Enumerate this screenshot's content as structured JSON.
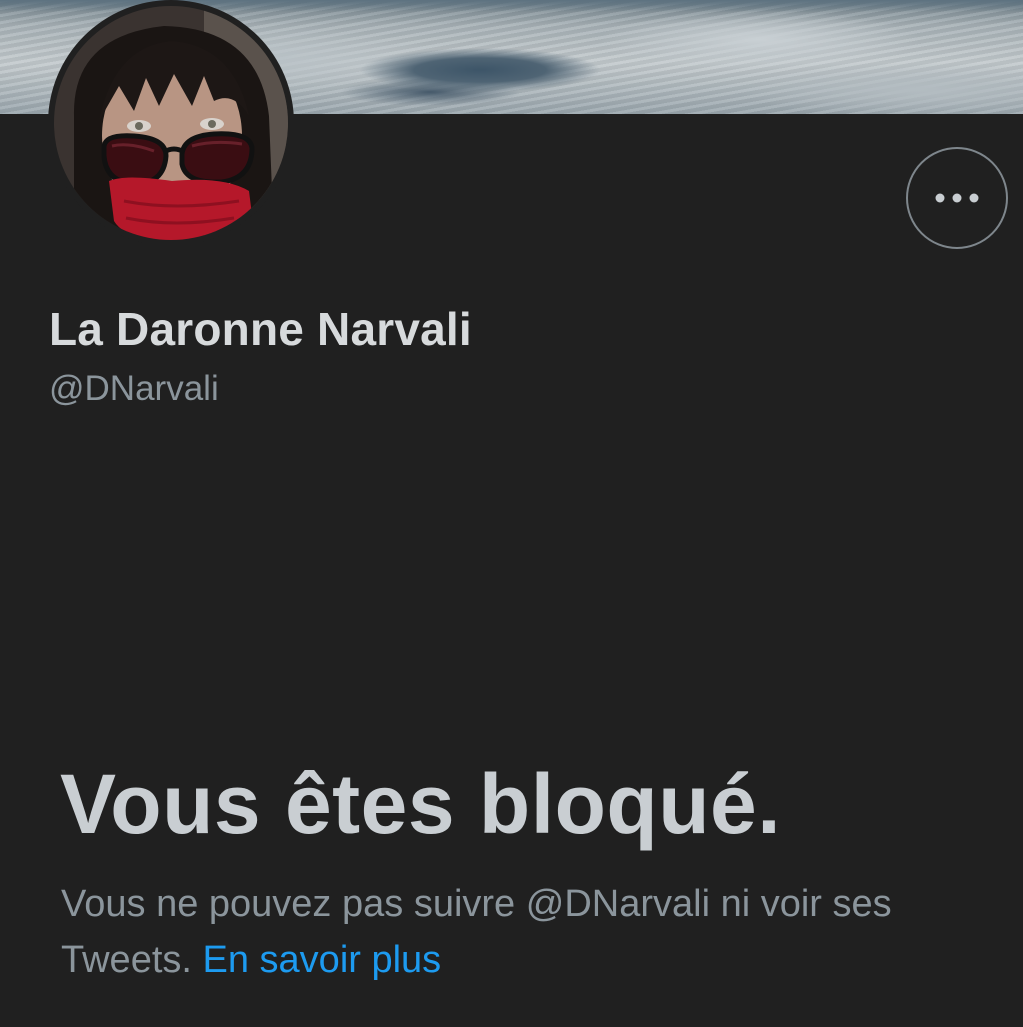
{
  "profile": {
    "display_name": "La Daronne Narvali",
    "handle": "@DNarvali"
  },
  "banner": {
    "description_icon": "cloud-landscape-image"
  },
  "actions": {
    "more_icon": "more-horizontal-icon"
  },
  "blocked": {
    "title": "Vous êtes bloqué.",
    "message": "Vous ne pouvez pas suivre @DNarvali ni voir ses Tweets.",
    "learn_more": "En savoir plus"
  },
  "colors": {
    "background": "#202020",
    "primary_text": "#d7dadc",
    "secondary_text": "#8b959c",
    "link": "#1d9bf0",
    "button_border": "#7e868c"
  }
}
